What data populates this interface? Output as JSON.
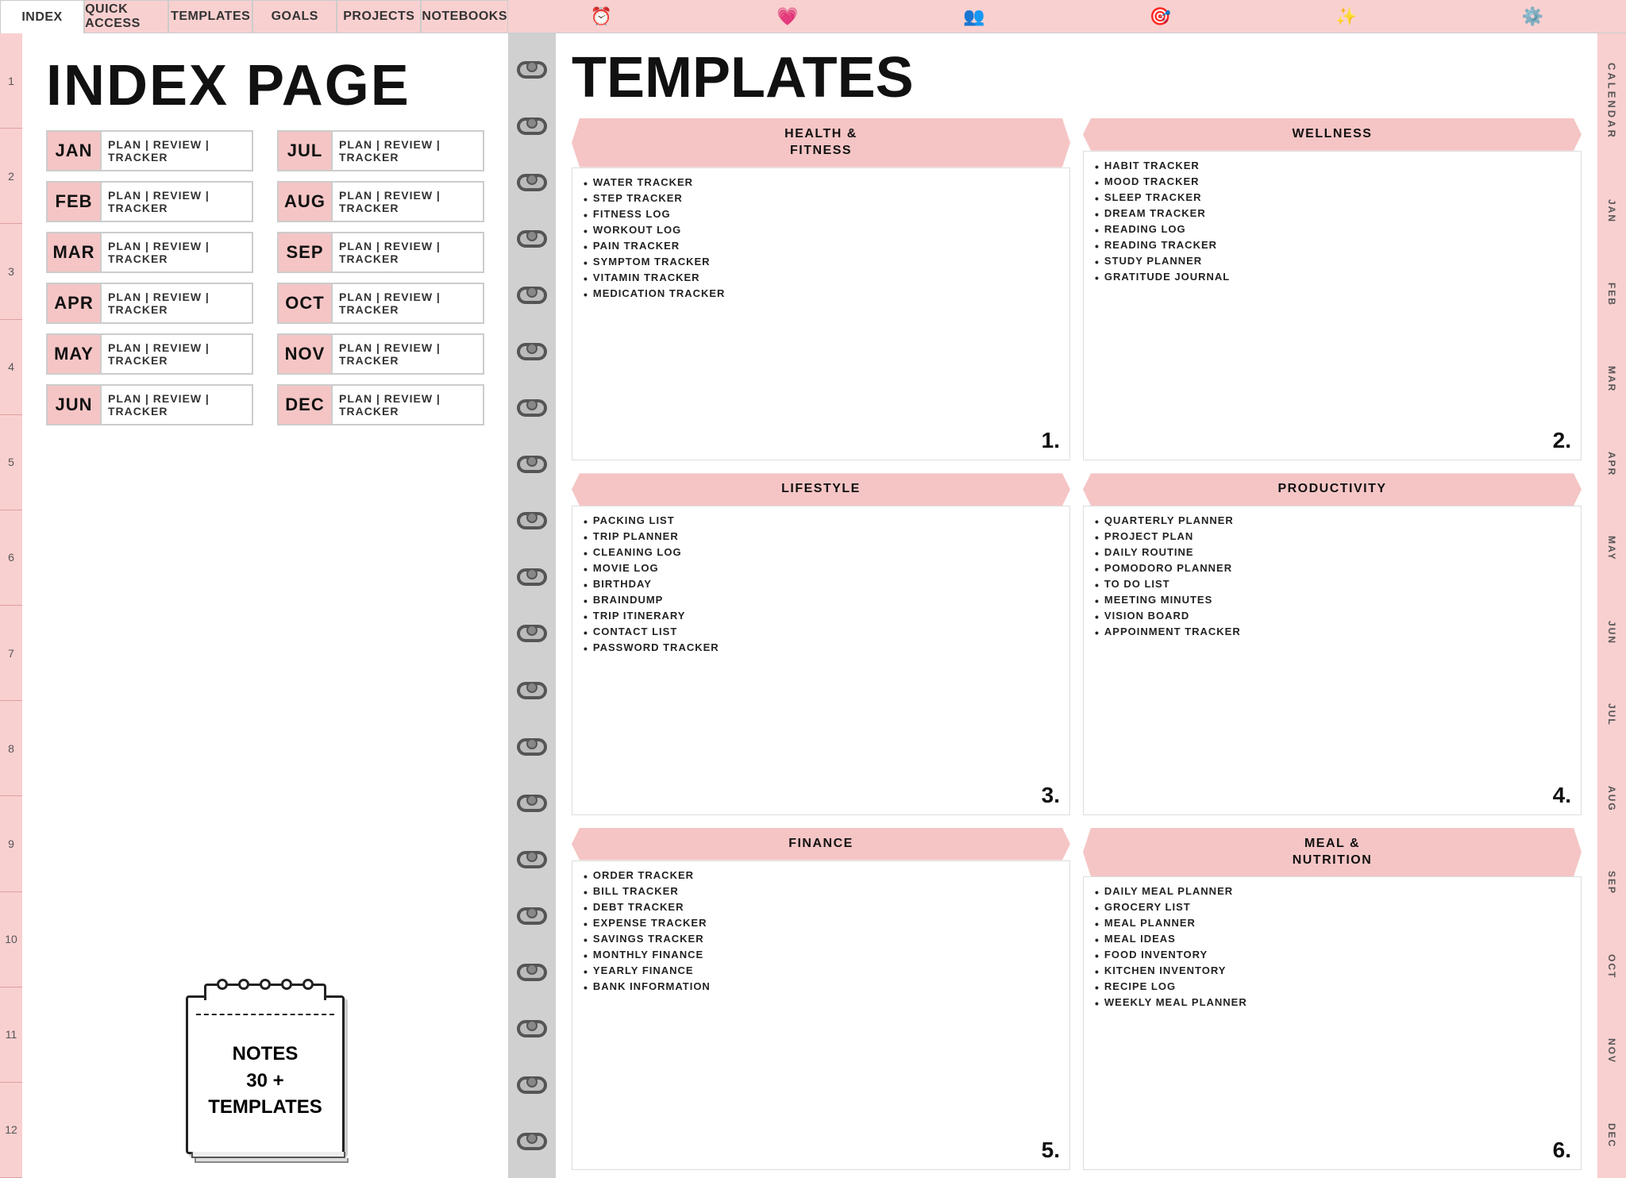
{
  "topNav": {
    "leftTabs": [
      {
        "label": "INDEX",
        "active": true
      },
      {
        "label": "QUICK ACCESS",
        "active": false
      },
      {
        "label": "TEMPLATES",
        "active": false
      },
      {
        "label": "GOALS",
        "active": false
      },
      {
        "label": "PROJECTS",
        "active": false
      },
      {
        "label": "NOTEBOOKS",
        "active": false
      }
    ],
    "rightIcons": [
      {
        "name": "alarm-icon",
        "symbol": "⏰"
      },
      {
        "name": "heart-icon",
        "symbol": "💗"
      },
      {
        "name": "people-icon",
        "symbol": "👥"
      },
      {
        "name": "target-icon",
        "symbol": "🎯"
      },
      {
        "name": "sparkle-icon",
        "symbol": "✨"
      },
      {
        "name": "gear-icon",
        "symbol": "⚙️"
      }
    ]
  },
  "leftPage": {
    "title": "INDEX PAGE",
    "rowNumbers": [
      "1",
      "2",
      "3",
      "4",
      "5",
      "6",
      "7",
      "8",
      "9",
      "10",
      "11",
      "12"
    ],
    "months": [
      {
        "label": "JAN",
        "plan": "PLAN | REVIEW | TRACKER",
        "pair": "JUL",
        "pairPlan": "PLAN | REVIEW | TRACKER"
      },
      {
        "label": "FEB",
        "plan": "PLAN | REVIEW | TRACKER",
        "pair": "AUG",
        "pairPlan": "PLAN | REVIEW | TRACKER"
      },
      {
        "label": "MAR",
        "plan": "PLAN | REVIEW | TRACKER",
        "pair": "SEP",
        "pairPlan": "PLAN | REVIEW | TRACKER"
      },
      {
        "label": "APR",
        "plan": "PLAN | REVIEW | TRACKER",
        "pair": "OCT",
        "pairPlan": "PLAN | REVIEW | TRACKER"
      },
      {
        "label": "MAY",
        "plan": "PLAN | REVIEW | TRACKER",
        "pair": "NOV",
        "pairPlan": "PLAN | REVIEW | TRACKER"
      },
      {
        "label": "JUN",
        "plan": "PLAN | REVIEW | TRACKER",
        "pair": "DEC",
        "pairPlan": "PLAN | REVIEW | TRACKER"
      }
    ],
    "notes": {
      "line1": "NOTES",
      "line2": "30 +",
      "line3": "TEMPLATES"
    }
  },
  "rightPage": {
    "title": "TEMPLATES",
    "calendarSidebar": [
      "CALENDAR",
      "JAN",
      "FEB",
      "MAR",
      "APR",
      "MAY",
      "JUN",
      "JUL",
      "AUG",
      "SEP",
      "OCT",
      "NOV",
      "DEC"
    ],
    "sections": [
      {
        "id": "health-fitness",
        "header": "HEALTH &\nFITNESS",
        "number": "1.",
        "items": [
          "WATER TRACKER",
          "STEP TRACKER",
          "FITNESS LOG",
          "WORKOUT LOG",
          "PAIN TRACKER",
          "SYMPTOM TRACKER",
          "VITAMIN TRACKER",
          "MEDICATION TRACKER"
        ]
      },
      {
        "id": "wellness",
        "header": "WELLNESS",
        "number": "2.",
        "items": [
          "HABIT TRACKER",
          "MOOD TRACKER",
          "SLEEP TRACKER",
          "DREAM TRACKER",
          "READING LOG",
          "READING TRACKER",
          "STUDY PLANNER",
          "GRATITUDE JOURNAL"
        ]
      },
      {
        "id": "lifestyle",
        "header": "LIFESTYLE",
        "number": "3.",
        "items": [
          "PACKING LIST",
          "TRIP PLANNER",
          "CLEANING LOG",
          "MOVIE LOG",
          "BIRTHDAY",
          "BRAINDUMP",
          "TRIP ITINERARY",
          "CONTACT LIST",
          "PASSWORD TRACKER"
        ]
      },
      {
        "id": "productivity",
        "header": "PRODUCTIVITY",
        "number": "4.",
        "items": [
          "QUARTERLY PLANNER",
          "PROJECT PLAN",
          "DAILY ROUTINE",
          "POMODORO PLANNER",
          "TO DO LIST",
          "MEETING MINUTES",
          "VISION BOARD",
          "APPOINMENT TRACKER"
        ]
      },
      {
        "id": "finance",
        "header": "FINANCE",
        "number": "5.",
        "items": [
          "ORDER TRACKER",
          "BILL TRACKER",
          "DEBT TRACKER",
          "EXPENSE TRACKER",
          "SAVINGS TRACKER",
          "MONTHLY FINANCE",
          "YEARLY FINANCE",
          "BANK INFORMATION"
        ]
      },
      {
        "id": "meal-nutrition",
        "header": "MEAL &\nNUTRITION",
        "number": "6.",
        "items": [
          "DAILY MEAL PLANNER",
          "GROCERY LIST",
          "MEAL PLANNER",
          "MEAL IDEAS",
          "FOOD INVENTORY",
          "KITCHEN INVENTORY",
          "RECIPE LOG",
          "WEEKLY MEAL PLANNER"
        ]
      }
    ]
  }
}
